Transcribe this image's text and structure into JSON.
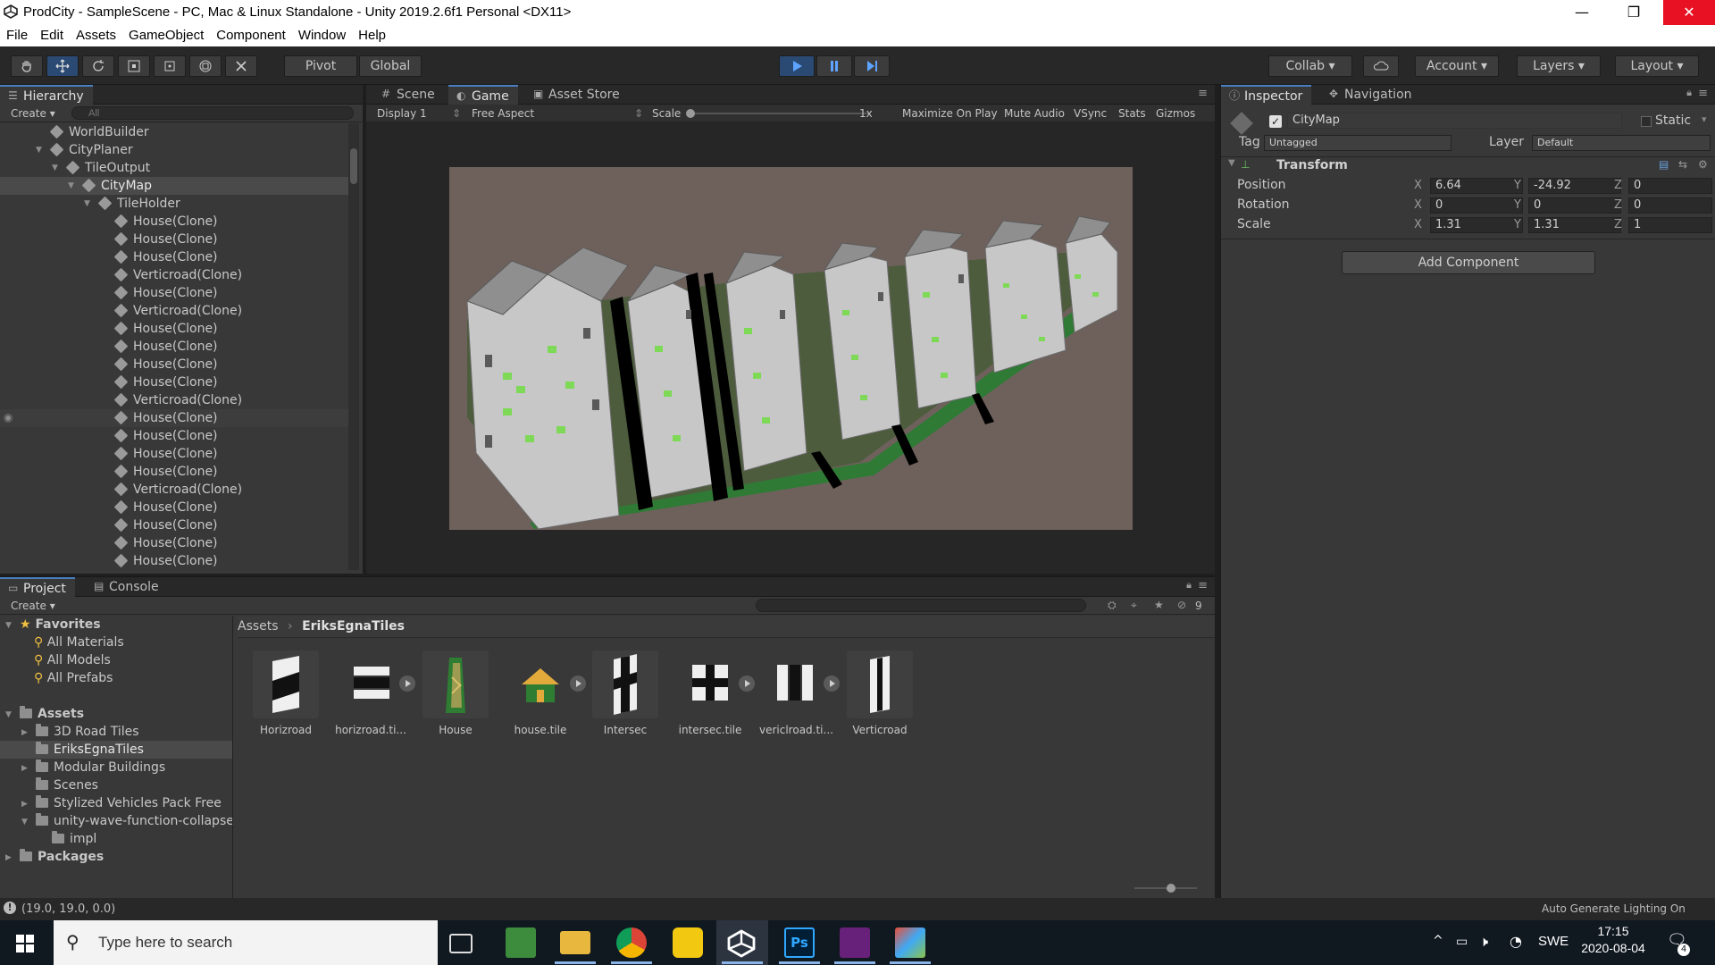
{
  "window": {
    "title": "ProdCity - SampleScene - PC, Mac & Linux Standalone - Unity 2019.2.6f1 Personal <DX11>",
    "minimize": "—",
    "restore": "❐",
    "close": "✕"
  },
  "menu": [
    "File",
    "Edit",
    "Assets",
    "GameObject",
    "Component",
    "Window",
    "Help"
  ],
  "toolbar": {
    "pivot": "Pivot",
    "global": "Global",
    "collab": "Collab",
    "account": "Account",
    "layers": "Layers",
    "layout": "Layout"
  },
  "hierarchy": {
    "tab": "Hierarchy",
    "create": "Create",
    "search_placeholder": "All",
    "items": [
      {
        "label": "WorldBuilder"
      },
      {
        "label": "CityPlaner"
      },
      {
        "label": "TileOutput"
      },
      {
        "label": "CityMap"
      },
      {
        "label": "TileHolder"
      },
      {
        "label": "House(Clone)"
      },
      {
        "label": "House(Clone)"
      },
      {
        "label": "House(Clone)"
      },
      {
        "label": "Verticroad(Clone)"
      },
      {
        "label": "House(Clone)"
      },
      {
        "label": "Verticroad(Clone)"
      },
      {
        "label": "House(Clone)"
      },
      {
        "label": "House(Clone)"
      },
      {
        "label": "House(Clone)"
      },
      {
        "label": "House(Clone)"
      },
      {
        "label": "Verticroad(Clone)"
      },
      {
        "label": "House(Clone)"
      },
      {
        "label": "House(Clone)"
      },
      {
        "label": "House(Clone)"
      },
      {
        "label": "House(Clone)"
      },
      {
        "label": "Verticroad(Clone)"
      },
      {
        "label": "House(Clone)"
      },
      {
        "label": "House(Clone)"
      },
      {
        "label": "House(Clone)"
      },
      {
        "label": "House(Clone)"
      }
    ]
  },
  "center_tabs": {
    "scene": "Scene",
    "game": "Game",
    "store": "Asset Store"
  },
  "game_bar": {
    "display": "Display 1",
    "aspect": "Free Aspect",
    "scale_label": "Scale",
    "scale_value": "1x",
    "maximize": "Maximize On Play",
    "mute": "Mute Audio",
    "vsync": "VSync",
    "stats": "Stats",
    "gizmos": "Gizmos"
  },
  "inspector": {
    "tab": "Inspector",
    "nav_tab": "Navigation",
    "object_name": "CityMap",
    "static": "Static",
    "tag_label": "Tag",
    "tag_value": "Untagged",
    "layer_label": "Layer",
    "layer_value": "Default",
    "component": "Transform",
    "position_label": "Position",
    "rotation_label": "Rotation",
    "scale_label": "Scale",
    "axis_x": "X",
    "axis_y": "Y",
    "axis_z": "Z",
    "position": {
      "x": "6.64",
      "y": "-24.92",
      "z": "0"
    },
    "rotation": {
      "x": "0",
      "y": "0",
      "z": "0"
    },
    "scale": {
      "x": "1.31",
      "y": "1.31",
      "z": "1"
    },
    "add_component": "Add Component"
  },
  "project": {
    "tab": "Project",
    "console_tab": "Console",
    "create": "Create",
    "hidden_count": "9",
    "favorites": "Favorites",
    "fav_items": [
      "All Materials",
      "All Models",
      "All Prefabs"
    ],
    "assets_root": "Assets",
    "asset_folders": [
      "3D Road Tiles",
      "EriksEgnaTiles",
      "Modular Buildings",
      "Scenes",
      "Stylized Vehicles Pack Free",
      "unity-wave-function-collapse",
      "impl"
    ],
    "packages": "Packages",
    "breadcrumb": [
      "Assets",
      "EriksEgnaTiles"
    ],
    "breadcrumb_sep": "›",
    "assets": [
      "Horizroad",
      "horizroad.ti...",
      "House",
      "house.tile",
      "Intersec",
      "intersec.tile",
      "vericlroad.ti...",
      "Verticroad"
    ]
  },
  "status": {
    "coords": "(19.0, 19.0, 0.0)",
    "lighting": "Auto Generate Lighting On"
  },
  "taskbar": {
    "search_placeholder": "Type here to search",
    "language": "SWE",
    "time": "17:15",
    "date": "2020-08-04",
    "notifications": "4"
  },
  "colors": {
    "editor_bg": "#383838",
    "panel_header": "#282828",
    "accent_blue": "#4a7fc1",
    "game_bg": "#6e615c",
    "taskbar": "#101820"
  }
}
